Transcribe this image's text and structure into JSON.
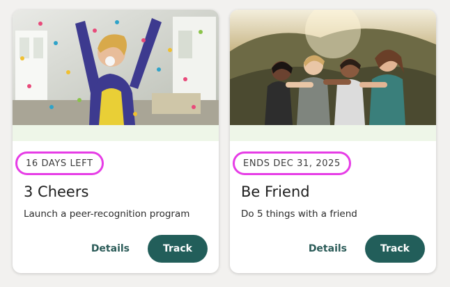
{
  "cards": [
    {
      "badge": "16 DAYS LEFT",
      "title": "3 Cheers",
      "description": "Launch a peer-recognition program",
      "details_label": "Details",
      "track_label": "Track"
    },
    {
      "badge": "ENDS DEC 31, 2025",
      "title": "Be Friend",
      "description": "Do 5 things with a friend",
      "details_label": "Details",
      "track_label": "Track"
    }
  ],
  "colors": {
    "page_background": "#f2f1ef",
    "badge_highlight": "#e63ce6",
    "track_button": "#225e5a",
    "details_link": "#2b5b58",
    "strip": "#eef6e8"
  }
}
